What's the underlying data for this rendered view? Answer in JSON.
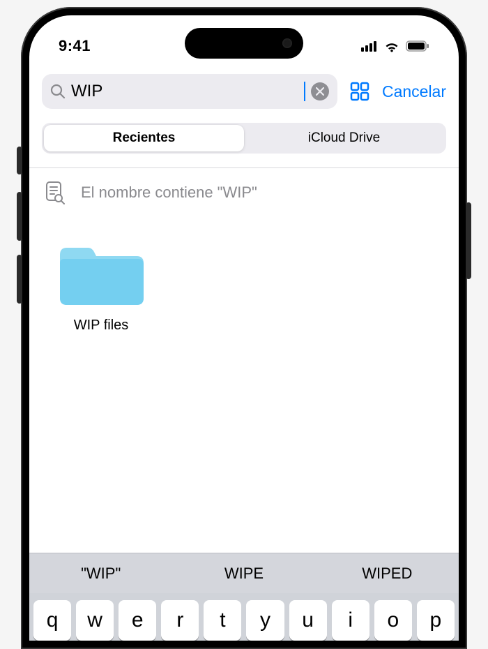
{
  "status": {
    "time": "9:41"
  },
  "search": {
    "value": "WIP",
    "cancel_label": "Cancelar"
  },
  "scope": {
    "tabs": [
      "Recientes",
      "iCloud Drive"
    ],
    "active_index": 0
  },
  "filter": {
    "text": "El nombre contiene \"WIP\""
  },
  "results": {
    "items": [
      {
        "name": "WIP files",
        "type": "folder"
      }
    ]
  },
  "keyboard": {
    "suggestions": [
      "\"WIP\"",
      "WIPE",
      "WIPED"
    ],
    "row_top": [
      "q",
      "w",
      "e",
      "r",
      "t",
      "y",
      "u",
      "i",
      "o",
      "p"
    ]
  },
  "colors": {
    "accent": "#007aff",
    "folder": "#74cff0"
  }
}
